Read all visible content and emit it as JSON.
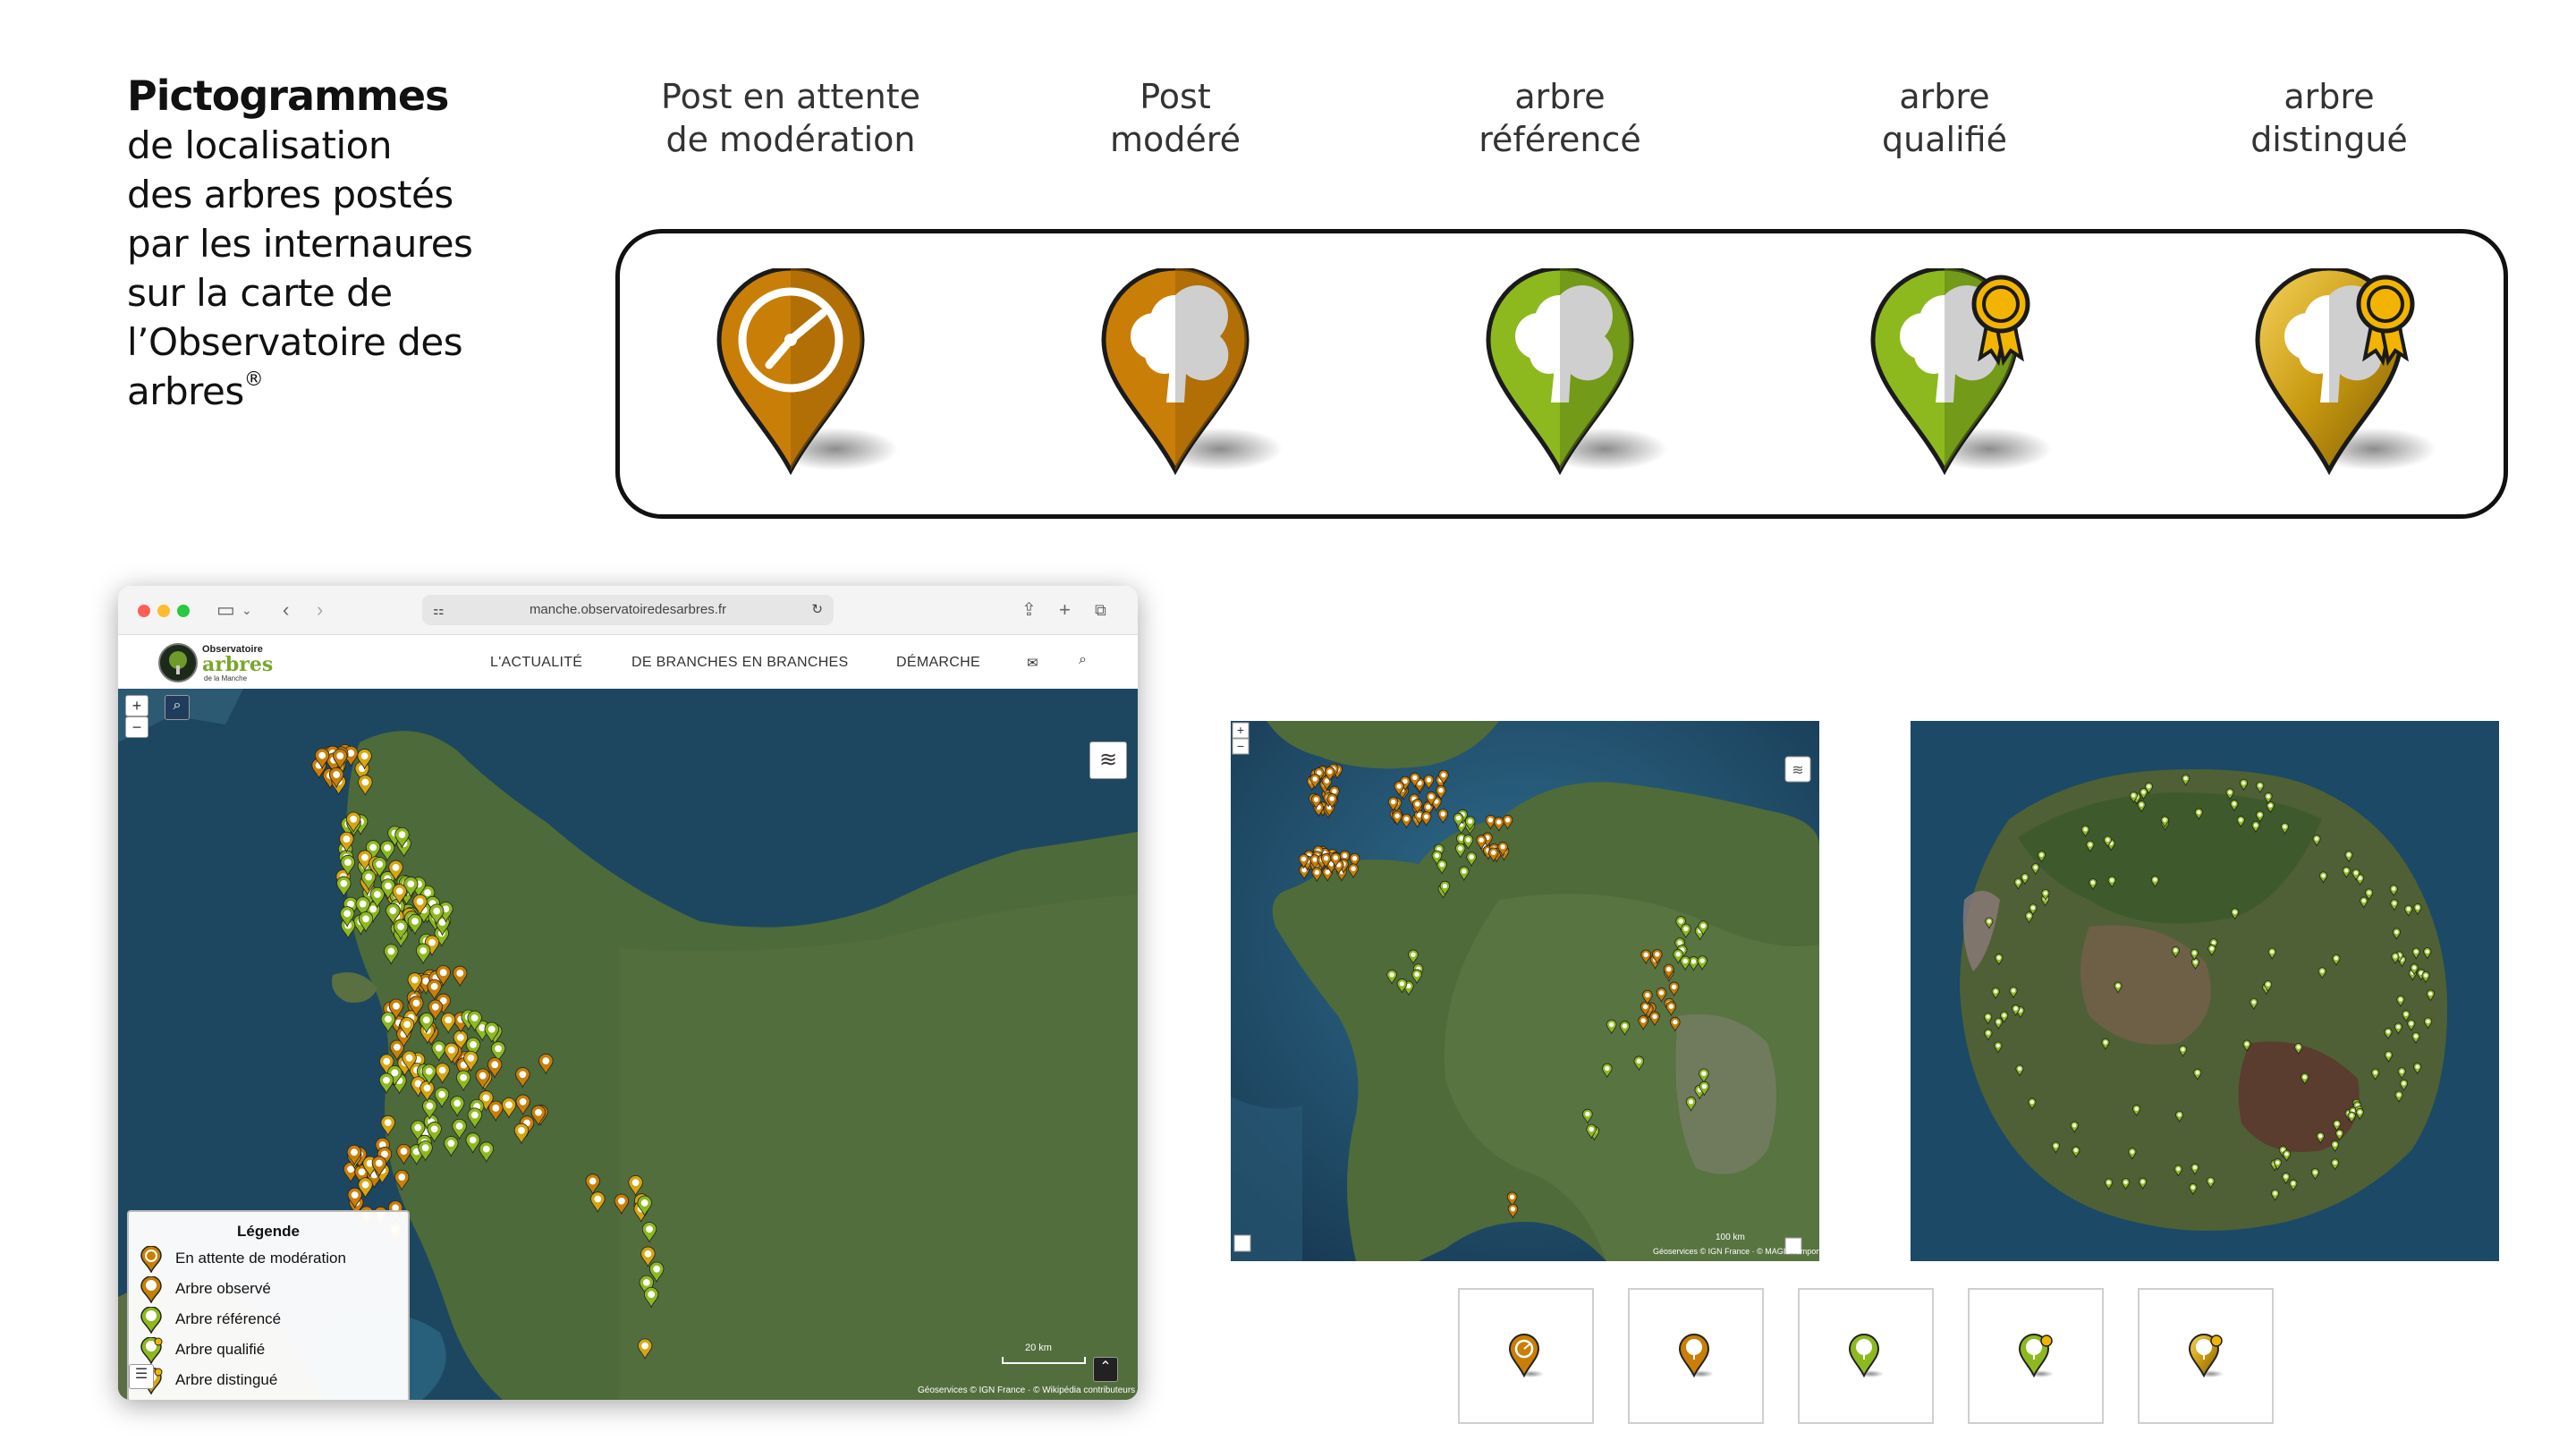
{
  "intro": {
    "title": "Pictogrammes",
    "lines": [
      "de localisation",
      "des arbres postés",
      "par les internaures",
      "sur la carte de",
      "l’Observatoire des arbres"
    ],
    "registered_mark": "®"
  },
  "pictograms": [
    {
      "caption_line1": "Post en attente",
      "caption_line2": "de modération",
      "icon": "clock-pin-icon",
      "color": "#c97f07"
    },
    {
      "caption_line1": "Post",
      "caption_line2": "modéré",
      "icon": "tree-pin-orange-icon",
      "color": "#c97f07"
    },
    {
      "caption_line1": "arbre",
      "caption_line2": "référencé",
      "icon": "tree-pin-green-icon",
      "color": "#8db91f"
    },
    {
      "caption_line1": "arbre",
      "caption_line2": "qualifié",
      "icon": "tree-pin-green-award-icon",
      "color": "#8db91f"
    },
    {
      "caption_line1": "arbre",
      "caption_line2": "distingué",
      "icon": "tree-pin-gold-award-icon",
      "color": "#d6a50f"
    }
  ],
  "browser": {
    "url": "manche.observatoiredesarbres.fr",
    "logo_line1": "Observatoire",
    "logo_line2": "arbres",
    "logo_line3": "de la Manche",
    "nav": [
      "L'ACTUALITÉ",
      "DE BRANCHES EN BRANCHES",
      "DÉMARCHE"
    ],
    "zoom_in": "+",
    "zoom_out": "−",
    "scale_label": "20 km",
    "attribution": "Géoservices © IGN France · © Wikipédia contributeurs"
  },
  "legend": {
    "title": "Légende",
    "items": [
      {
        "label": "En attente de modération",
        "color": "#c97f07"
      },
      {
        "label": "Arbre observé",
        "color": "#c97f07"
      },
      {
        "label": "Arbre référencé",
        "color": "#8db91f"
      },
      {
        "label": "Arbre qualifié",
        "color": "#8db91f"
      },
      {
        "label": "Arbre distingué",
        "color": "#d6a50f"
      }
    ]
  },
  "france_map": {
    "scale_label": "100 km",
    "attribution": "Géoservices © IGN France · © MAGIS remporte"
  },
  "colors": {
    "orange": "#c97f07",
    "green": "#8db91f",
    "gold": "#d6a50f",
    "sea": "#1f4a66",
    "land": "#4f6b3a"
  }
}
